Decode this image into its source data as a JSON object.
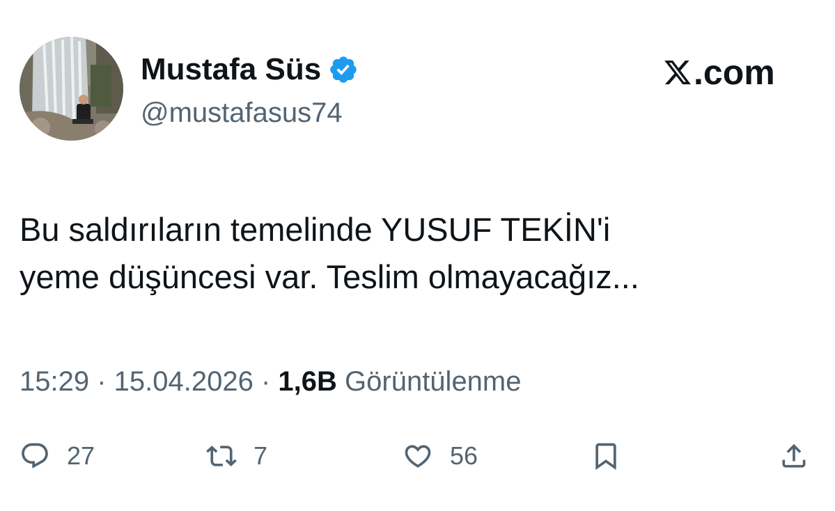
{
  "author": {
    "display_name": "Mustafa Süs",
    "handle": "@mustafasus74",
    "verified": true
  },
  "brand": {
    "label": ".com"
  },
  "tweet": {
    "text": "Bu saldırıların temelinde YUSUF TEKİN'i\nyeme düşüncesi var. Teslim olmayacağız...",
    "time": "15:29",
    "sep1": " · ",
    "date": "15.04.2026",
    "sep2": " · ",
    "views_count": "1,6B",
    "views_label": " Görüntülenme"
  },
  "actions": {
    "replies": "27",
    "reposts": "7",
    "likes": "56"
  },
  "colors": {
    "text": "#0f1419",
    "secondary": "#536471",
    "verified": "#1d9bf0",
    "background": "#ffffff"
  },
  "icons": {
    "reply": "speech-bubble-icon",
    "repost": "repost-arrows-icon",
    "like": "heart-icon",
    "bookmark": "bookmark-icon",
    "share": "share-upload-icon",
    "verified": "verified-badge-icon",
    "brand": "x-logo-icon"
  }
}
